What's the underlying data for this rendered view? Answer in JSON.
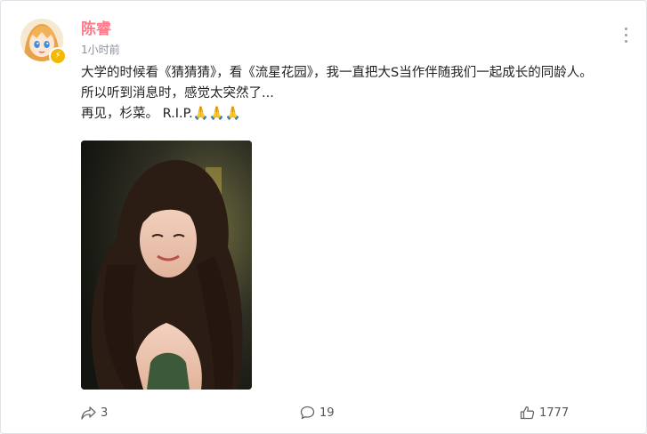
{
  "post": {
    "author": "陈睿",
    "time": "1小时前",
    "lines": [
      "大学的时候看《猜猜猜》，看《流星花园》，我一直把大S当作伴随我们一起成长的同龄人。",
      "所以听到消息时，感觉太突然了...",
      "再见，杉菜。 R.I.P.🙏🙏🙏"
    ],
    "photo_icon": "portrait-photo",
    "avatar_icon": "anime-girl-avatar",
    "badge_icon": "lightning-badge-icon"
  },
  "actions": {
    "share_count": "3",
    "comment_count": "19",
    "like_count": "1777"
  },
  "colors": {
    "author": "#ff7a8a",
    "badge": "#f5b800"
  }
}
